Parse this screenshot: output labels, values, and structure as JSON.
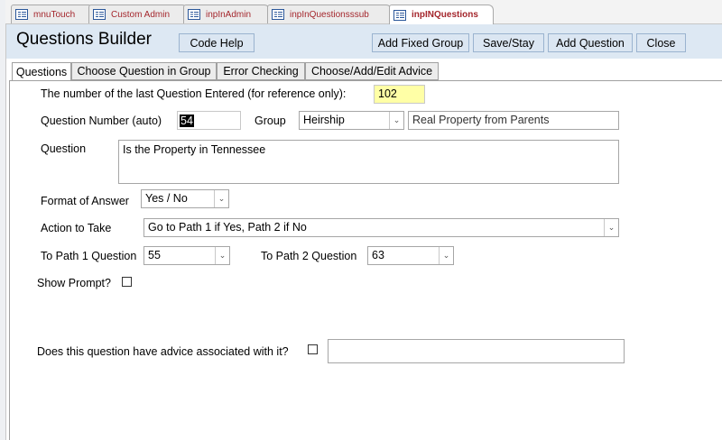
{
  "doc_tabs": [
    "mnuTouch",
    "Custom Admin",
    "inpInAdmin",
    "inpInQuestionsssub",
    "inpINQuestions"
  ],
  "form": {
    "title": "Questions Builder",
    "buttons": {
      "code_help": "Code Help",
      "add_fixed_group": "Add Fixed Group",
      "save_stay": "Save/Stay",
      "add_question": "Add Question",
      "close": "Close"
    }
  },
  "page_tabs": [
    "Questions",
    "Choose Question in Group",
    "Error Checking",
    "Choose/Add/Edit Advice"
  ],
  "fields": {
    "last_question_label": "The number of the last Question Entered (for reference only):",
    "last_question_value": "102",
    "question_number_label": "Question Number (auto)",
    "question_number_value": "54",
    "group_label": "Group",
    "group_value": "Heirship",
    "group_description": "Real Property from Parents",
    "question_label": "Question",
    "question_value": "Is the Property in Tennessee",
    "format_label": "Format of Answer",
    "format_value": "Yes / No",
    "action_label": "Action to Take",
    "action_value": "Go to Path 1 if Yes, Path 2 if No",
    "path1_label": "To Path 1 Question",
    "path1_value": "55",
    "path2_label": "To Path 2 Question",
    "path2_value": "63",
    "show_prompt_label": "Show Prompt?",
    "advice_label": "Does this question have advice associated with it?",
    "advice_value": ""
  },
  "colors": {
    "header_bg": "#dde8f3",
    "button_bg": "#dbe6f2",
    "highlight_field": "#ffffa6",
    "tab_text": "#a4262c"
  }
}
